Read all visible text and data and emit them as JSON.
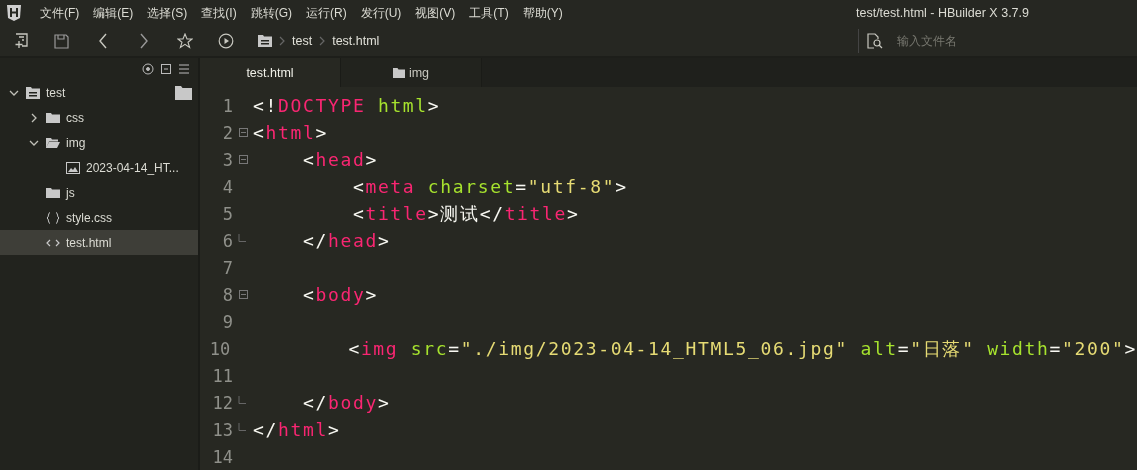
{
  "window": {
    "title": "test/test.html - HBuilder X 3.7.9"
  },
  "menu": [
    "文件(F)",
    "编辑(E)",
    "选择(S)",
    "查找(I)",
    "跳转(G)",
    "运行(R)",
    "发行(U)",
    "视图(V)",
    "工具(T)",
    "帮助(Y)"
  ],
  "breadcrumb": [
    "test",
    "test.html"
  ],
  "file_search": {
    "placeholder": "输入文件名"
  },
  "tree": [
    {
      "label": "test",
      "kind": "project",
      "expanded": true,
      "selected": false,
      "children": [
        {
          "label": "css",
          "kind": "folder",
          "expanded": false,
          "selected": false
        },
        {
          "label": "img",
          "kind": "folder",
          "expanded": true,
          "selected": false,
          "children": [
            {
              "label": "2023-04-14_HT...",
              "kind": "image",
              "selected": false
            }
          ]
        },
        {
          "label": "js",
          "kind": "folder",
          "selected": false
        },
        {
          "label": "style.css",
          "kind": "css",
          "selected": false
        },
        {
          "label": "test.html",
          "kind": "html",
          "selected": true
        }
      ]
    }
  ],
  "tabs": [
    {
      "label": "test.html",
      "kind": "file",
      "selected": true
    },
    {
      "label": "img",
      "kind": "folder",
      "selected": false
    }
  ],
  "code": [
    {
      "number": "1",
      "fold_start": false,
      "fold_end": false,
      "tokens": [
        {
          "kind": "punct",
          "text": "<!"
        },
        {
          "kind": "tag",
          "text": "DOCTYPE"
        },
        {
          "kind": "attr",
          "text": " html"
        },
        {
          "kind": "punct",
          "text": ">"
        }
      ]
    },
    {
      "number": "2",
      "fold_start": true,
      "fold_end": false,
      "tokens": [
        {
          "kind": "punct",
          "text": "<"
        },
        {
          "kind": "tag",
          "text": "html"
        },
        {
          "kind": "punct",
          "text": ">"
        }
      ]
    },
    {
      "number": "3",
      "fold_start": true,
      "fold_end": false,
      "tokens": [
        {
          "kind": "punct",
          "text": "    <"
        },
        {
          "kind": "tag",
          "text": "head"
        },
        {
          "kind": "punct",
          "text": ">"
        }
      ]
    },
    {
      "number": "4",
      "fold_start": false,
      "fold_end": false,
      "tokens": [
        {
          "kind": "punct",
          "text": "        <"
        },
        {
          "kind": "tag",
          "text": "meta"
        },
        {
          "kind": "attr",
          "text": " charset"
        },
        {
          "kind": "punct",
          "text": "="
        },
        {
          "kind": "str",
          "text": "\"utf-8\""
        },
        {
          "kind": "punct",
          "text": ">"
        }
      ]
    },
    {
      "number": "5",
      "fold_start": false,
      "fold_end": false,
      "tokens": [
        {
          "kind": "punct",
          "text": "        <"
        },
        {
          "kind": "tag",
          "text": "title"
        },
        {
          "kind": "punct",
          "text": ">"
        },
        {
          "kind": "text",
          "text": "测试"
        },
        {
          "kind": "punct",
          "text": "</"
        },
        {
          "kind": "tag",
          "text": "title"
        },
        {
          "kind": "punct",
          "text": ">"
        }
      ]
    },
    {
      "number": "6",
      "fold_start": false,
      "fold_end": true,
      "tokens": [
        {
          "kind": "punct",
          "text": "    </"
        },
        {
          "kind": "tag",
          "text": "head"
        },
        {
          "kind": "punct",
          "text": ">"
        }
      ]
    },
    {
      "number": "7",
      "fold_start": false,
      "fold_end": false
    },
    {
      "number": "8",
      "fold_start": true,
      "fold_end": false,
      "tokens": [
        {
          "kind": "punct",
          "text": "    <"
        },
        {
          "kind": "tag",
          "text": "body"
        },
        {
          "kind": "punct",
          "text": ">"
        }
      ]
    },
    {
      "number": "9",
      "fold_start": false,
      "fold_end": false
    },
    {
      "number": "10",
      "fold_start": false,
      "fold_end": false,
      "tokens": [
        {
          "kind": "punct",
          "text": "        <"
        },
        {
          "kind": "tag",
          "text": "img"
        },
        {
          "kind": "attr",
          "text": " src"
        },
        {
          "kind": "punct",
          "text": "="
        },
        {
          "kind": "str",
          "text": "\"./img/2023-04-14_HTML5_06.jpg\""
        },
        {
          "kind": "attr",
          "text": " alt"
        },
        {
          "kind": "punct",
          "text": "="
        },
        {
          "kind": "str",
          "text": "\"日落\""
        },
        {
          "kind": "attr",
          "text": " width"
        },
        {
          "kind": "punct",
          "text": "="
        },
        {
          "kind": "str",
          "text": "\"200\""
        },
        {
          "kind": "punct",
          "text": ">"
        }
      ]
    },
    {
      "number": "11",
      "fold_start": false,
      "fold_end": false
    },
    {
      "number": "12",
      "fold_start": false,
      "fold_end": true,
      "tokens": [
        {
          "kind": "punct",
          "text": "    </"
        },
        {
          "kind": "tag",
          "text": "body"
        },
        {
          "kind": "punct",
          "text": ">"
        }
      ]
    },
    {
      "number": "13",
      "fold_start": false,
      "fold_end": true,
      "tokens": [
        {
          "kind": "punct",
          "text": "</"
        },
        {
          "kind": "tag",
          "text": "html"
        },
        {
          "kind": "punct",
          "text": ">"
        }
      ]
    },
    {
      "number": "14",
      "fold_start": false,
      "fold_end": false
    }
  ]
}
